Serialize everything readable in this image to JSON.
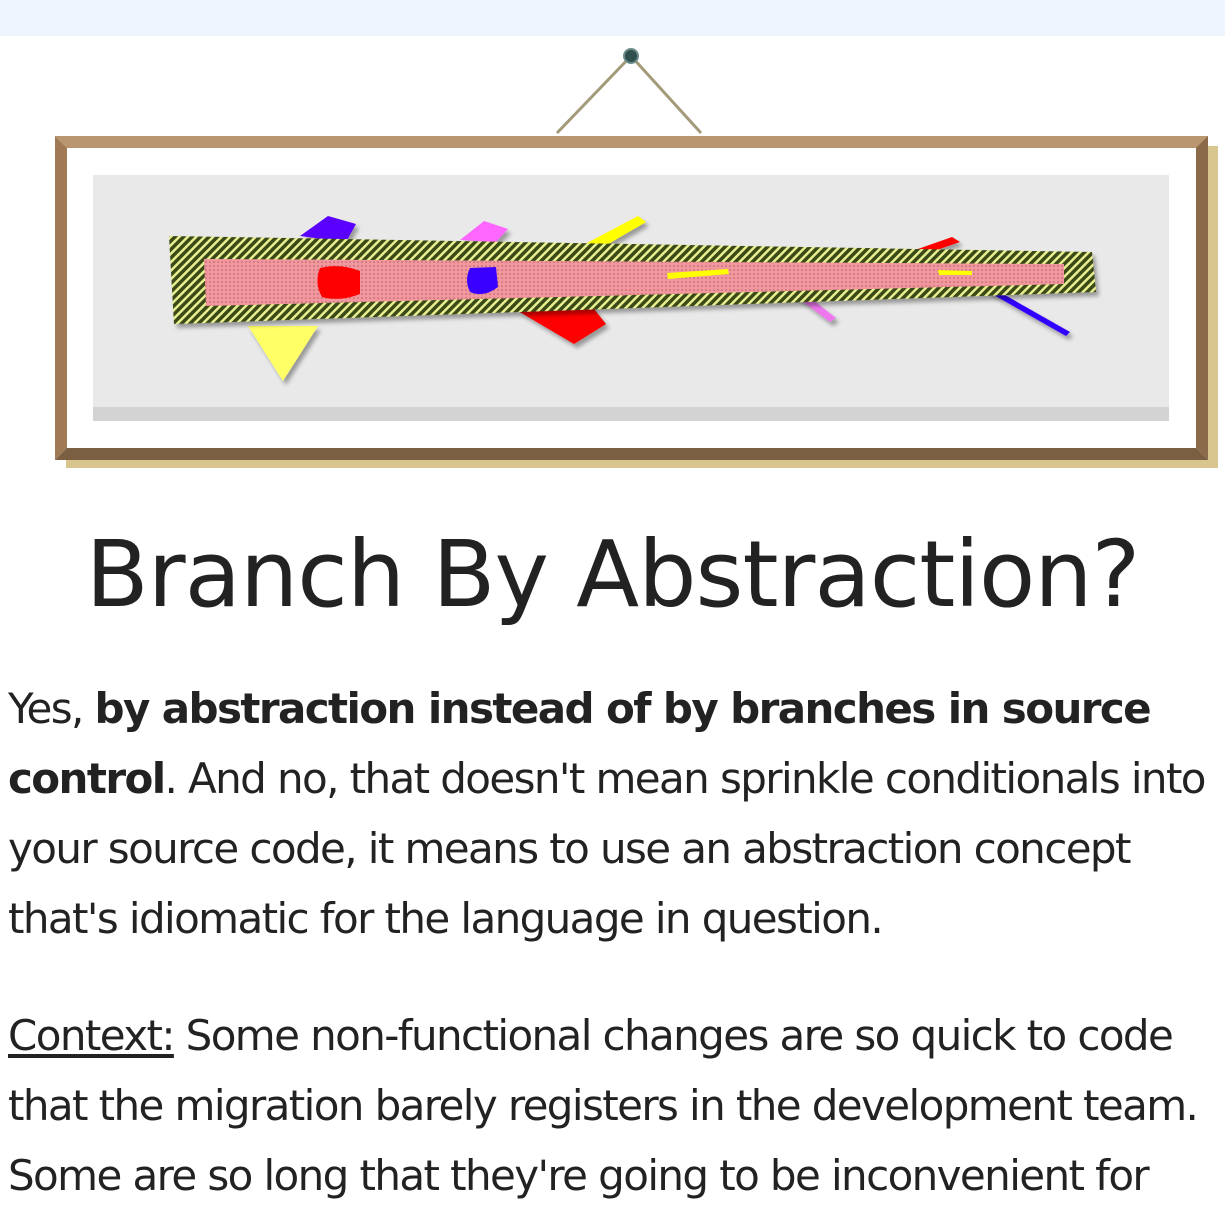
{
  "header": {
    "background": "#eef5fe"
  },
  "illustration": {
    "frame_color": "#b5906a",
    "frame_shadow_color": "#d9c68f",
    "matting_color": "#ffffff",
    "canvas_color": "#e9e9e9",
    "trunk_color": "#5c6b2e",
    "branch_color": "#f29aa0",
    "accent_colors": [
      "#5a00ff",
      "#ff66ff",
      "#ffff00",
      "#ff0000",
      "#3300ff",
      "#ff77ff"
    ]
  },
  "article": {
    "title": "Branch By Abstraction?",
    "intro": {
      "lead": "Yes, ",
      "bold": "by abstraction instead of by branches in source",
      "bold_line2": "control",
      "rest_line2": ". And no, that doesn't mean sprinkle conditionals into",
      "line3": "your source code, it means to use an abstraction concept",
      "line4": "that's idiomatic for the language in question."
    },
    "context": {
      "label": "Context:",
      "rest_line1": " Some non-functional changes are so quick to code",
      "line2": "that the migration barely registers in the development team.",
      "line3": "Some are so long that they're going to be inconvenient for"
    }
  }
}
